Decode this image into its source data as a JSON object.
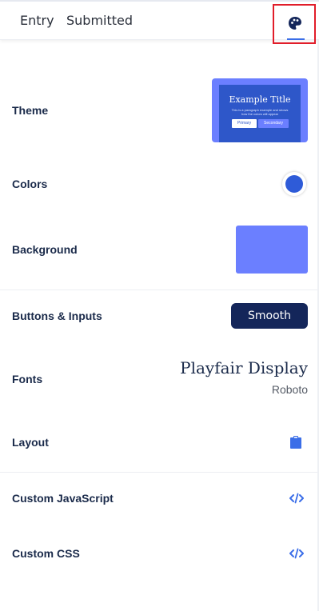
{
  "tabs": {
    "entry": "Entry",
    "submitted": "Submitted",
    "theme_icon": "palette-icon"
  },
  "settings": {
    "theme": {
      "label": "Theme",
      "preview_title": "Example Title",
      "preview_text": "This is a paragraph example and shows how the colors will appear",
      "preview_primary": "Primary",
      "preview_secondary": "Secondary"
    },
    "colors": {
      "label": "Colors",
      "value": "#2e5bd8"
    },
    "background": {
      "label": "Background",
      "value": "#6b7fff"
    },
    "buttons_inputs": {
      "label": "Buttons & Inputs",
      "value": "Smooth"
    },
    "fonts": {
      "label": "Fonts",
      "heading": "Playfair Display",
      "body": "Roboto"
    },
    "layout": {
      "label": "Layout",
      "icon": "clipboard-icon"
    },
    "custom_js": {
      "label": "Custom JavaScript",
      "icon": "code-icon"
    },
    "custom_css": {
      "label": "Custom CSS",
      "icon": "code-icon"
    }
  },
  "colors": {
    "accent": "#3b6ee8",
    "navy": "#14265a",
    "highlight": "#e11d2a"
  }
}
